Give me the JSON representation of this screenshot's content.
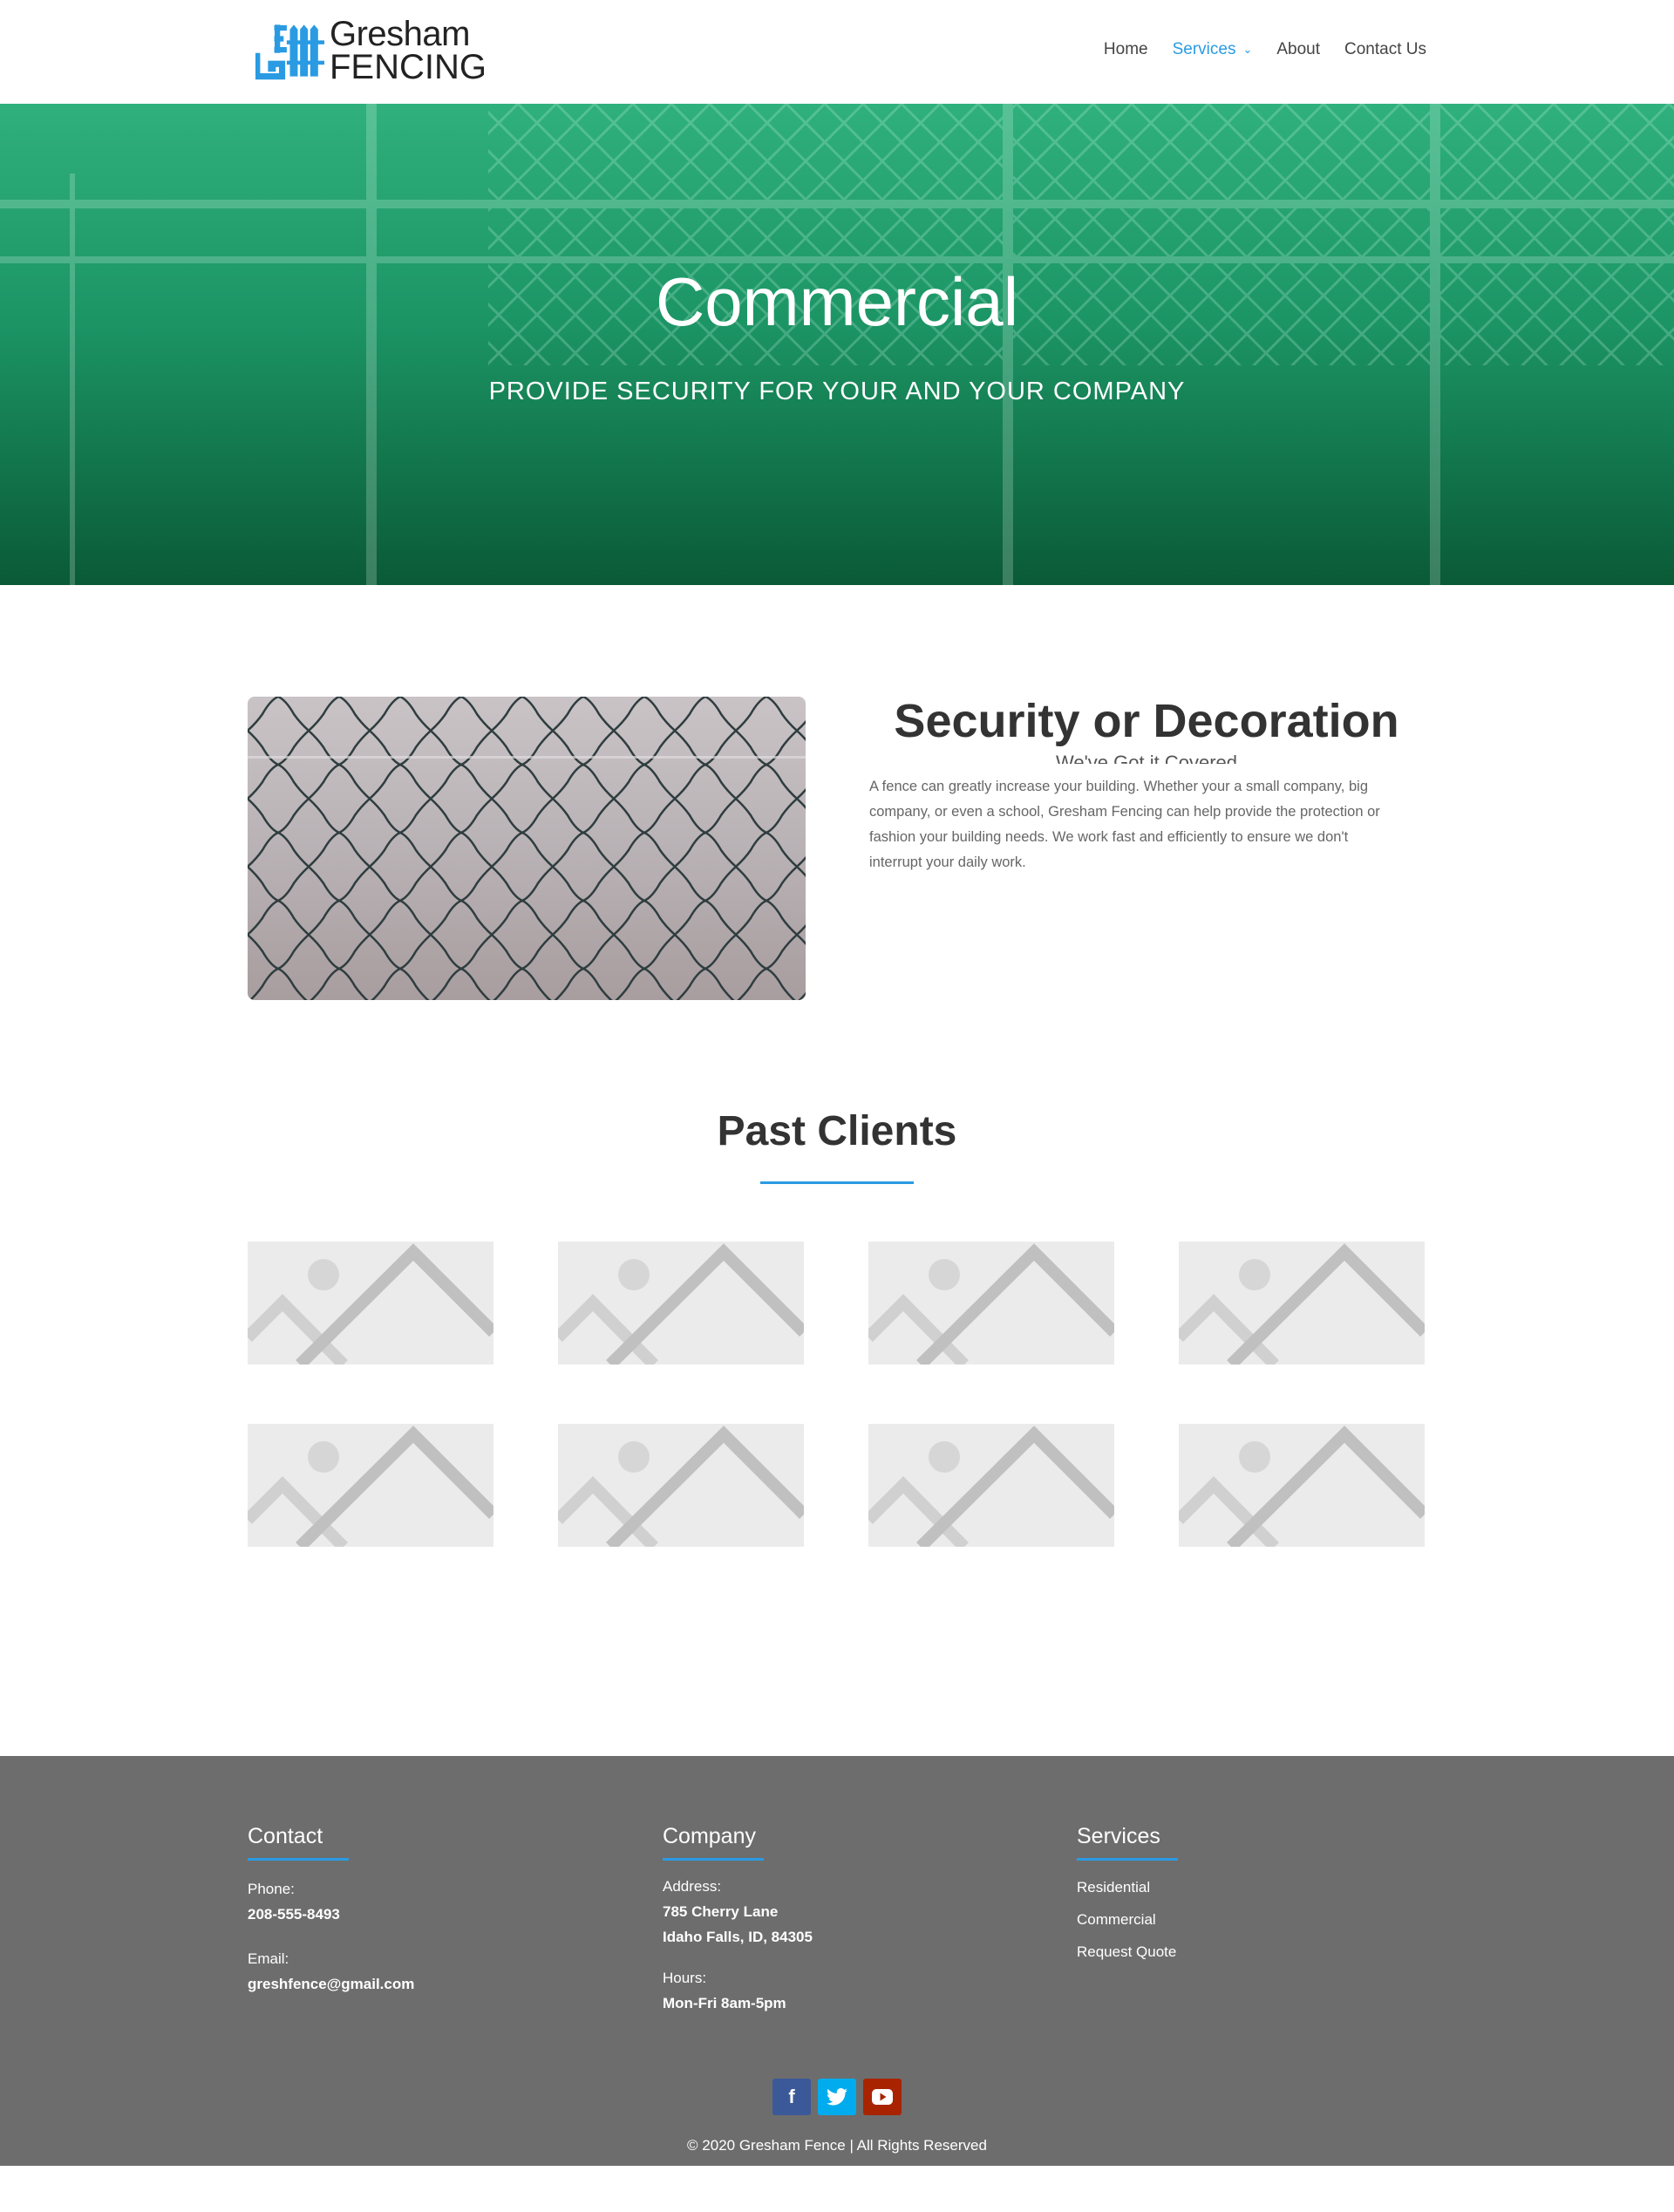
{
  "header": {
    "logo": {
      "line1": "Gresham",
      "line2": "FENCING"
    },
    "nav": {
      "home": "Home",
      "services": "Services",
      "about": "About",
      "contact": "Contact Us"
    }
  },
  "hero": {
    "title": "Commercial",
    "subtitle": "PROVIDE SECURITY FOR YOUR AND YOUR COMPANY"
  },
  "feature": {
    "title": "Security or Decoration",
    "subtitle": "We've Got it Covered",
    "text": "A fence can greatly increase your building. Whether your a small company, big company, or even a school, Gresham Fencing can help provide the protection or fashion your building needs. We work fast and efficiently to ensure we don't interrupt your daily work."
  },
  "clients": {
    "title": "Past Clients"
  },
  "footer": {
    "contact": {
      "heading": "Contact",
      "phone_label": "Phone:",
      "phone": "208-555-8493",
      "email_label": "Email:",
      "email": "greshfence@gmail.com"
    },
    "company": {
      "heading": "Company",
      "address_label": "Address:",
      "address_line1": "785 Cherry Lane",
      "address_line2": "Idaho Falls, ID, 84305",
      "hours_label": "Hours:",
      "hours": "Mon-Fri 8am-5pm"
    },
    "services": {
      "heading": "Services",
      "links": [
        "Residential",
        "Commercial",
        "Request Quote"
      ]
    },
    "social": {
      "facebook": "f",
      "twitter": "t",
      "youtube": "▶"
    },
    "copyright": "© 2020 Gresham Fence | All Rights Reserved"
  },
  "colors": {
    "accent": "#2a9be3",
    "hero_green": "#1c9565",
    "footer_bg": "#6d6d6d",
    "facebook": "#3b5998",
    "twitter": "#00aced",
    "youtube": "#a82400"
  }
}
